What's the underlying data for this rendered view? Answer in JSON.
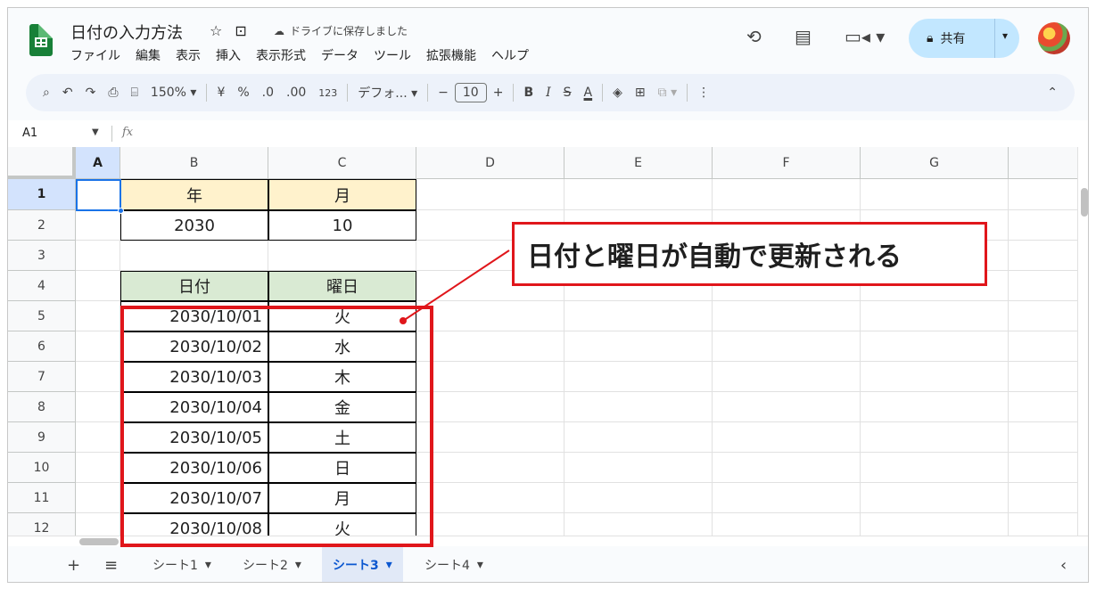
{
  "header": {
    "doc_title": "日付の入力方法",
    "saved_status": "ドライブに保存しました",
    "menu": [
      "ファイル",
      "編集",
      "表示",
      "挿入",
      "表示形式",
      "データ",
      "ツール",
      "拡張機能",
      "ヘルプ"
    ],
    "share_label": "共有"
  },
  "toolbar": {
    "zoom": "150%",
    "currency": "¥",
    "percent": "%",
    "dec_decrease": ".0",
    "dec_increase": ".00",
    "number_format": "123",
    "font": "デフォ...",
    "font_size": "10",
    "bold": "B",
    "italic": "I",
    "text_color": "A"
  },
  "formula_bar": {
    "name_box": "A1",
    "fx": "fx"
  },
  "columns": [
    "A",
    "B",
    "C",
    "D",
    "E",
    "F",
    "G"
  ],
  "rows": [
    "1",
    "2",
    "3",
    "4",
    "5",
    "6",
    "7",
    "8",
    "9",
    "10",
    "11",
    "12"
  ],
  "cells": {
    "B1": "年",
    "C1": "月",
    "B2": "2030",
    "C2": "10",
    "B4": "日付",
    "C4": "曜日",
    "B5": "2030/10/01",
    "C5": "火",
    "B6": "2030/10/02",
    "C6": "水",
    "B7": "2030/10/03",
    "C7": "木",
    "B8": "2030/10/04",
    "C8": "金",
    "B9": "2030/10/05",
    "C9": "土",
    "B10": "2030/10/06",
    "C10": "日",
    "B11": "2030/10/07",
    "C11": "月",
    "B12": "2030/10/08",
    "C12": "火"
  },
  "sheet_tabs": [
    "シート1",
    "シート2",
    "シート3",
    "シート4"
  ],
  "active_tab": "シート3",
  "annotation": "日付と曜日が自動で更新される",
  "colors": {
    "highlight": "#e0161b",
    "header_yellow": "#fff2cc",
    "header_green": "#d9ead3",
    "selection": "#1a73e8"
  }
}
